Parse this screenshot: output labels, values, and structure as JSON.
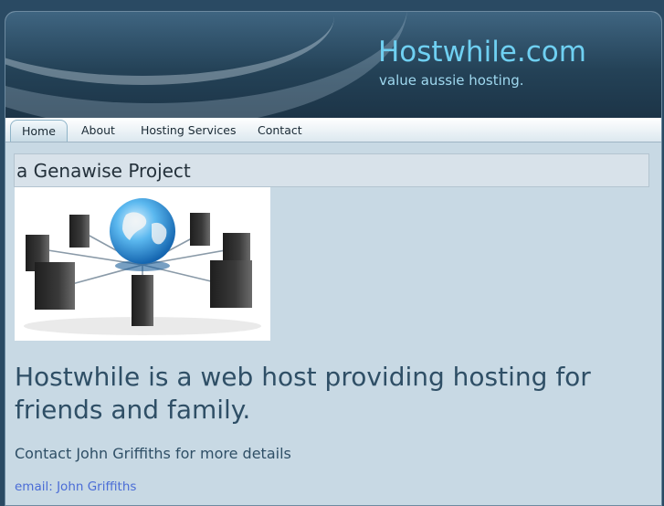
{
  "header": {
    "site_title": "Hostwhile.com",
    "tagline": "value aussie hosting."
  },
  "nav": {
    "tabs": [
      {
        "label": "Home",
        "active": true
      },
      {
        "label": "About",
        "active": false
      },
      {
        "label": "Hosting Services",
        "active": false
      },
      {
        "label": "Contact",
        "active": false
      }
    ]
  },
  "main": {
    "banner": "a Genawise Project",
    "headline": "Hostwhile is a web host providing hosting for friends and family.",
    "subhead": "Contact John Griffiths for more details",
    "email_prefix": "email: ",
    "email_link": "John Griffiths"
  },
  "colors": {
    "accent": "#6fd0f2",
    "header_bg": "#244257",
    "content_bg": "#c8d9e4",
    "headline": "#2f4f66",
    "link": "#4a6cd6"
  }
}
